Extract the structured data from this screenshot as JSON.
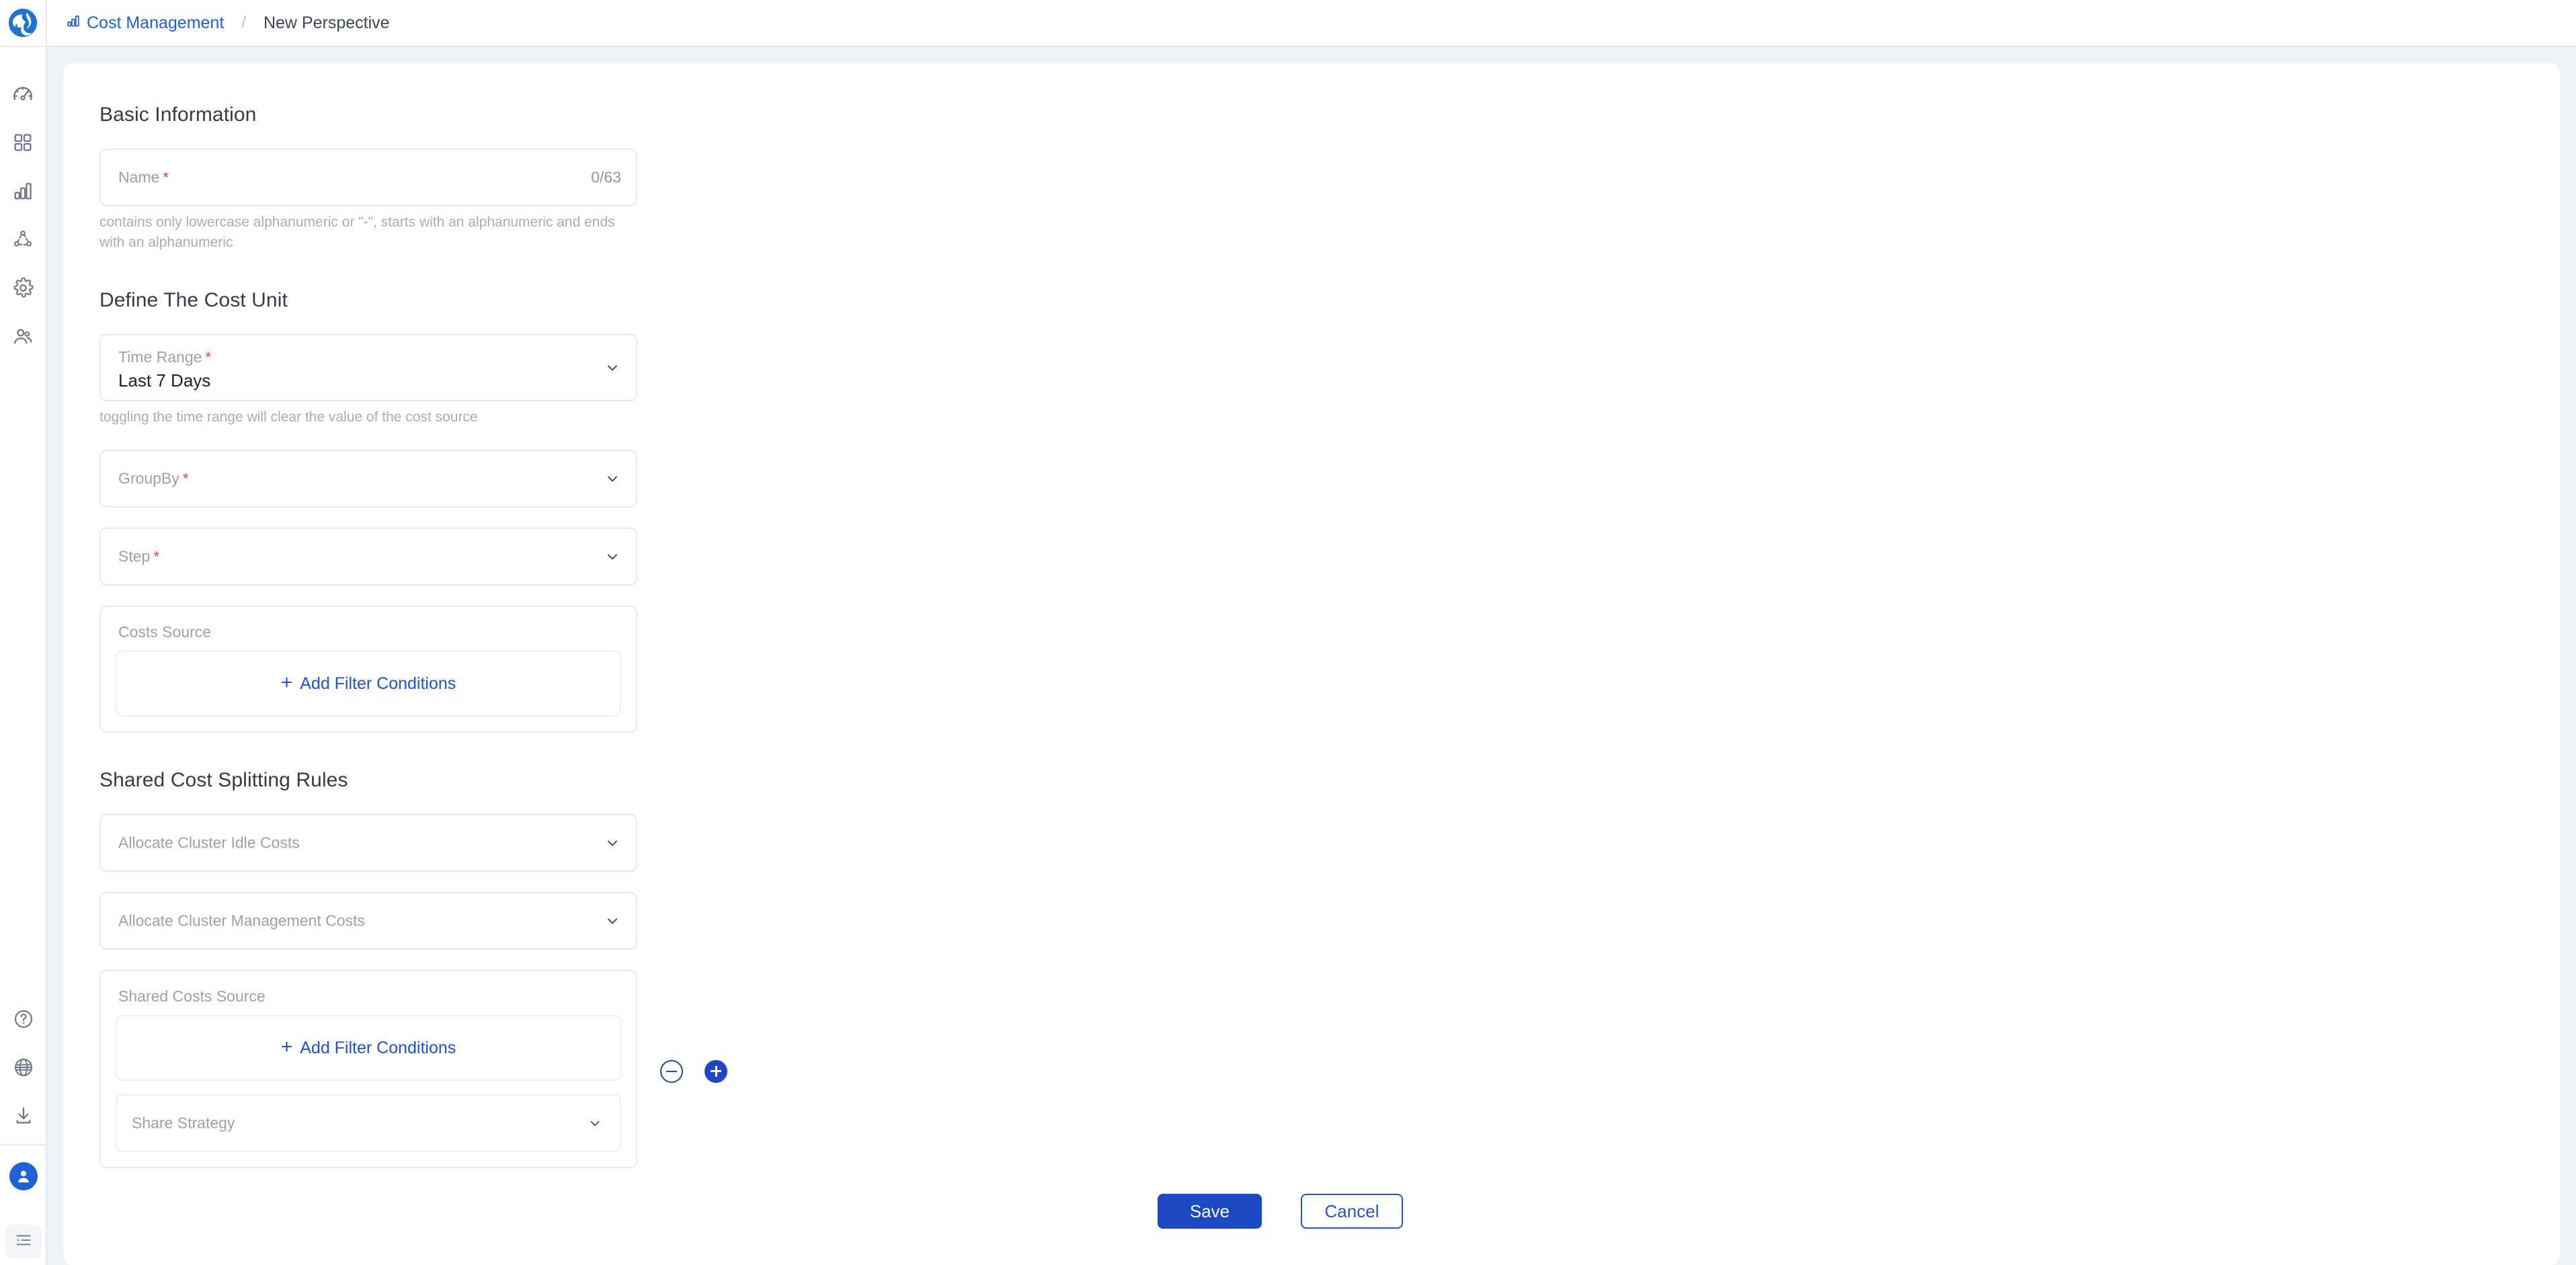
{
  "app": {
    "logo_name": "fish-logo"
  },
  "sidebar": {
    "top_items": [
      {
        "name": "dashboard",
        "icon": "gauge-icon"
      },
      {
        "name": "workloads",
        "icon": "grid-icon"
      },
      {
        "name": "cost-management",
        "icon": "bar-chart-icon"
      },
      {
        "name": "topology",
        "icon": "network-icon"
      },
      {
        "name": "settings",
        "icon": "gear-icon"
      },
      {
        "name": "users",
        "icon": "users-icon"
      }
    ],
    "bottom_items": [
      {
        "name": "help",
        "icon": "question-circle-icon"
      },
      {
        "name": "language",
        "icon": "globe-icon"
      },
      {
        "name": "downloads",
        "icon": "download-icon"
      }
    ],
    "avatar": {
      "name": "user-avatar",
      "icon": "person-icon"
    },
    "collapse": {
      "name": "collapse-sidebar",
      "icon": "list-indent-icon"
    }
  },
  "breadcrumb": {
    "icon": "bar-chart-icon",
    "parent": "Cost Management",
    "separator": "/",
    "current": "New Perspective"
  },
  "sections": {
    "basic": {
      "title": "Basic Information",
      "name_field": {
        "label": "Name",
        "required": "*",
        "value": "",
        "counter": "0/63",
        "helper": "contains only lowercase alphanumeric or \"-\", starts with an alphanumeric and ends with an alphanumeric"
      }
    },
    "cost_unit": {
      "title": "Define The Cost Unit",
      "time_range": {
        "label": "Time Range",
        "required": "*",
        "value": "Last 7 Days",
        "helper": "toggling the time range will clear the value of the cost source"
      },
      "group_by": {
        "label": "GroupBy",
        "required": "*",
        "value": ""
      },
      "step": {
        "label": "Step",
        "required": "*",
        "value": ""
      },
      "costs_source": {
        "label": "Costs Source",
        "add_filter_label": "Add Filter Conditions",
        "add_filter_plus": "+"
      }
    },
    "shared_rules": {
      "title": "Shared Cost Splitting Rules",
      "allocate_idle": {
        "label": "Allocate Cluster Idle Costs",
        "value": ""
      },
      "allocate_management": {
        "label": "Allocate Cluster Management Costs",
        "value": ""
      },
      "shared_costs_source": {
        "label": "Shared Costs Source",
        "add_filter_label": "Add Filter Conditions",
        "add_filter_plus": "+",
        "share_strategy": {
          "label": "Share Strategy",
          "value": ""
        }
      },
      "row_buttons": {
        "remove": "remove-rule",
        "add": "add-rule"
      }
    }
  },
  "footer": {
    "save_label": "Save",
    "cancel_label": "Cancel"
  },
  "colors": {
    "accent": "#1f62d4",
    "primary_button": "#1c48c3",
    "link": "#1f51d3",
    "required": "#e8463c",
    "page_bg": "#eff2f7"
  }
}
